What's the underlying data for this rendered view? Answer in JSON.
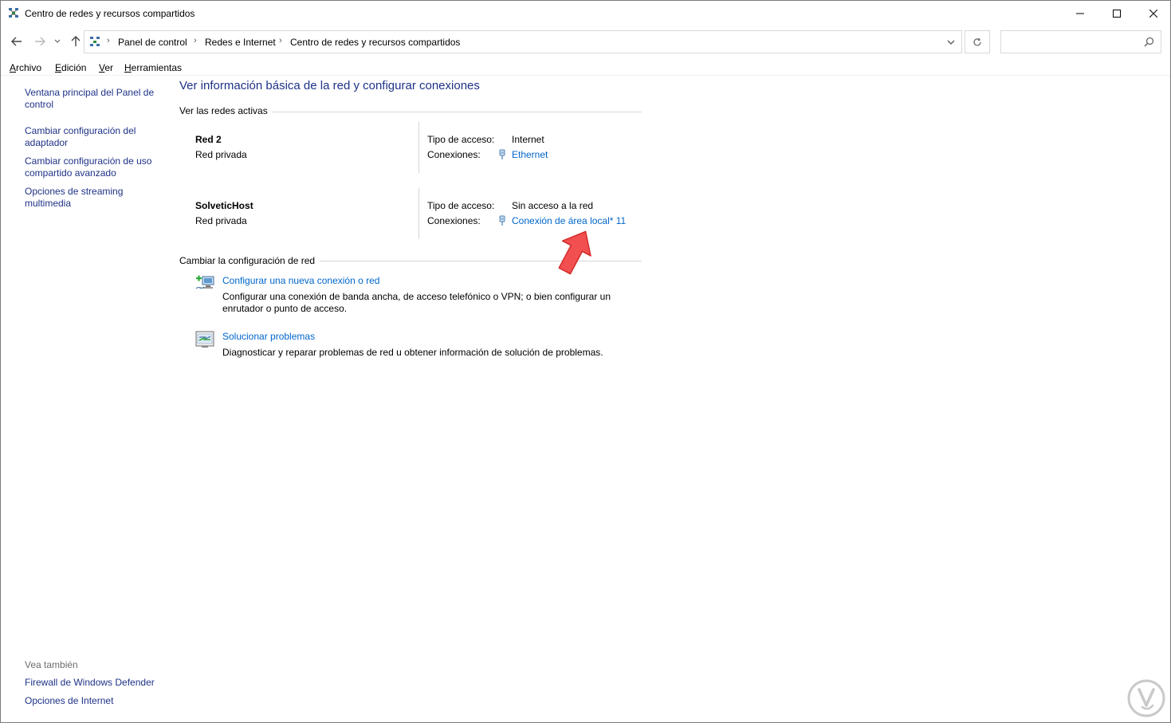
{
  "window": {
    "title": "Centro de redes y recursos compartidos",
    "icon": "network-center-icon",
    "controls": {
      "minimize": "minimize-icon",
      "maximize": "maximize-icon",
      "close": "close-icon"
    }
  },
  "address": {
    "crumbs": [
      "Panel de control",
      "Redes e Internet",
      "Centro de redes y recursos compartidos"
    ],
    "search_placeholder": ""
  },
  "menu": {
    "items": [
      {
        "accel": "A",
        "rest": "rchivo"
      },
      {
        "accel": "E",
        "rest": "dición"
      },
      {
        "accel": "V",
        "rest": "er"
      },
      {
        "accel": "H",
        "rest": "erramientas"
      }
    ]
  },
  "sidebar": {
    "links": [
      "Ventana principal del Panel de control",
      "Cambiar configuración del adaptador",
      "Cambiar configuración de uso compartido avanzado",
      "Opciones de streaming multimedia"
    ],
    "see_also_label": "Vea también",
    "see_also": [
      "Firewall de Windows Defender",
      "Opciones de Internet"
    ]
  },
  "main": {
    "title": "Ver información básica de la red y configurar conexiones",
    "active_networks_label": "Ver las redes activas",
    "networks": [
      {
        "name": "Red 2",
        "type": "Red privada",
        "access_label": "Tipo de acceso:",
        "access_value": "Internet",
        "connections_label": "Conexiones:",
        "connection": "Ethernet"
      },
      {
        "name": "SolveticHost",
        "type": "Red privada",
        "access_label": "Tipo de acceso:",
        "access_value": "Sin acceso a la red",
        "connections_label": "Conexiones:",
        "connection": "Conexión de área local* 11"
      }
    ],
    "change_settings_label": "Cambiar la configuración de red",
    "tasks": [
      {
        "link": "Configurar una nueva conexión o red",
        "desc": "Configurar una conexión de banda ancha, de acceso telefónico o VPN; o bien configurar un enrutador o punto de acceso."
      },
      {
        "link": "Solucionar problemas",
        "desc": "Diagnosticar y reparar problemas de red u obtener información de solución de problemas."
      }
    ]
  },
  "colors": {
    "link": "#0066cc",
    "heading": "#1e3287",
    "arrow": "#f04848"
  }
}
